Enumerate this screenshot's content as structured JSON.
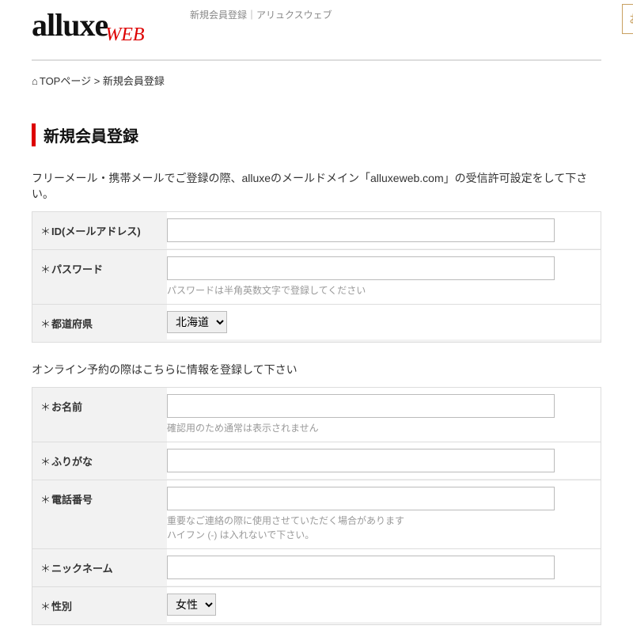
{
  "header": {
    "page_subtitle": "新規会員登録｜アリュクスウェブ",
    "logo_main": "alluxe",
    "logo_sub": "WEB",
    "right_button": "お"
  },
  "breadcrumb": {
    "home_icon": "⌂",
    "home_label": "TOPページ",
    "sep": " > ",
    "current": "新規会員登録"
  },
  "page_title": "新規会員登録",
  "section1": {
    "instruction": "フリーメール・携帯メールでご登録の際、alluxeのメールドメイン「alluxeweb.com」の受信許可設定をして下さい。",
    "fields": [
      {
        "label": "ID(メールアドレス)",
        "hint": ""
      },
      {
        "label": "パスワード",
        "hint": "パスワードは半角英数文字で登録してください"
      },
      {
        "label": "都道府県",
        "type": "select",
        "value": "北海道"
      }
    ]
  },
  "section2": {
    "instruction": "オンライン予約の際はこちらに情報を登録して下さい",
    "fields": [
      {
        "label": "お名前",
        "hint": "確認用のため通常は表示されません"
      },
      {
        "label": "ふりがな",
        "hint": ""
      },
      {
        "label": "電話番号",
        "hint": "重要なご連絡の際に使用させていただく場合があります\nハイフン (-) は入れないで下さい。"
      },
      {
        "label": "ニックネーム",
        "hint": ""
      },
      {
        "label": "性別",
        "type": "select",
        "value": "女性"
      }
    ]
  }
}
